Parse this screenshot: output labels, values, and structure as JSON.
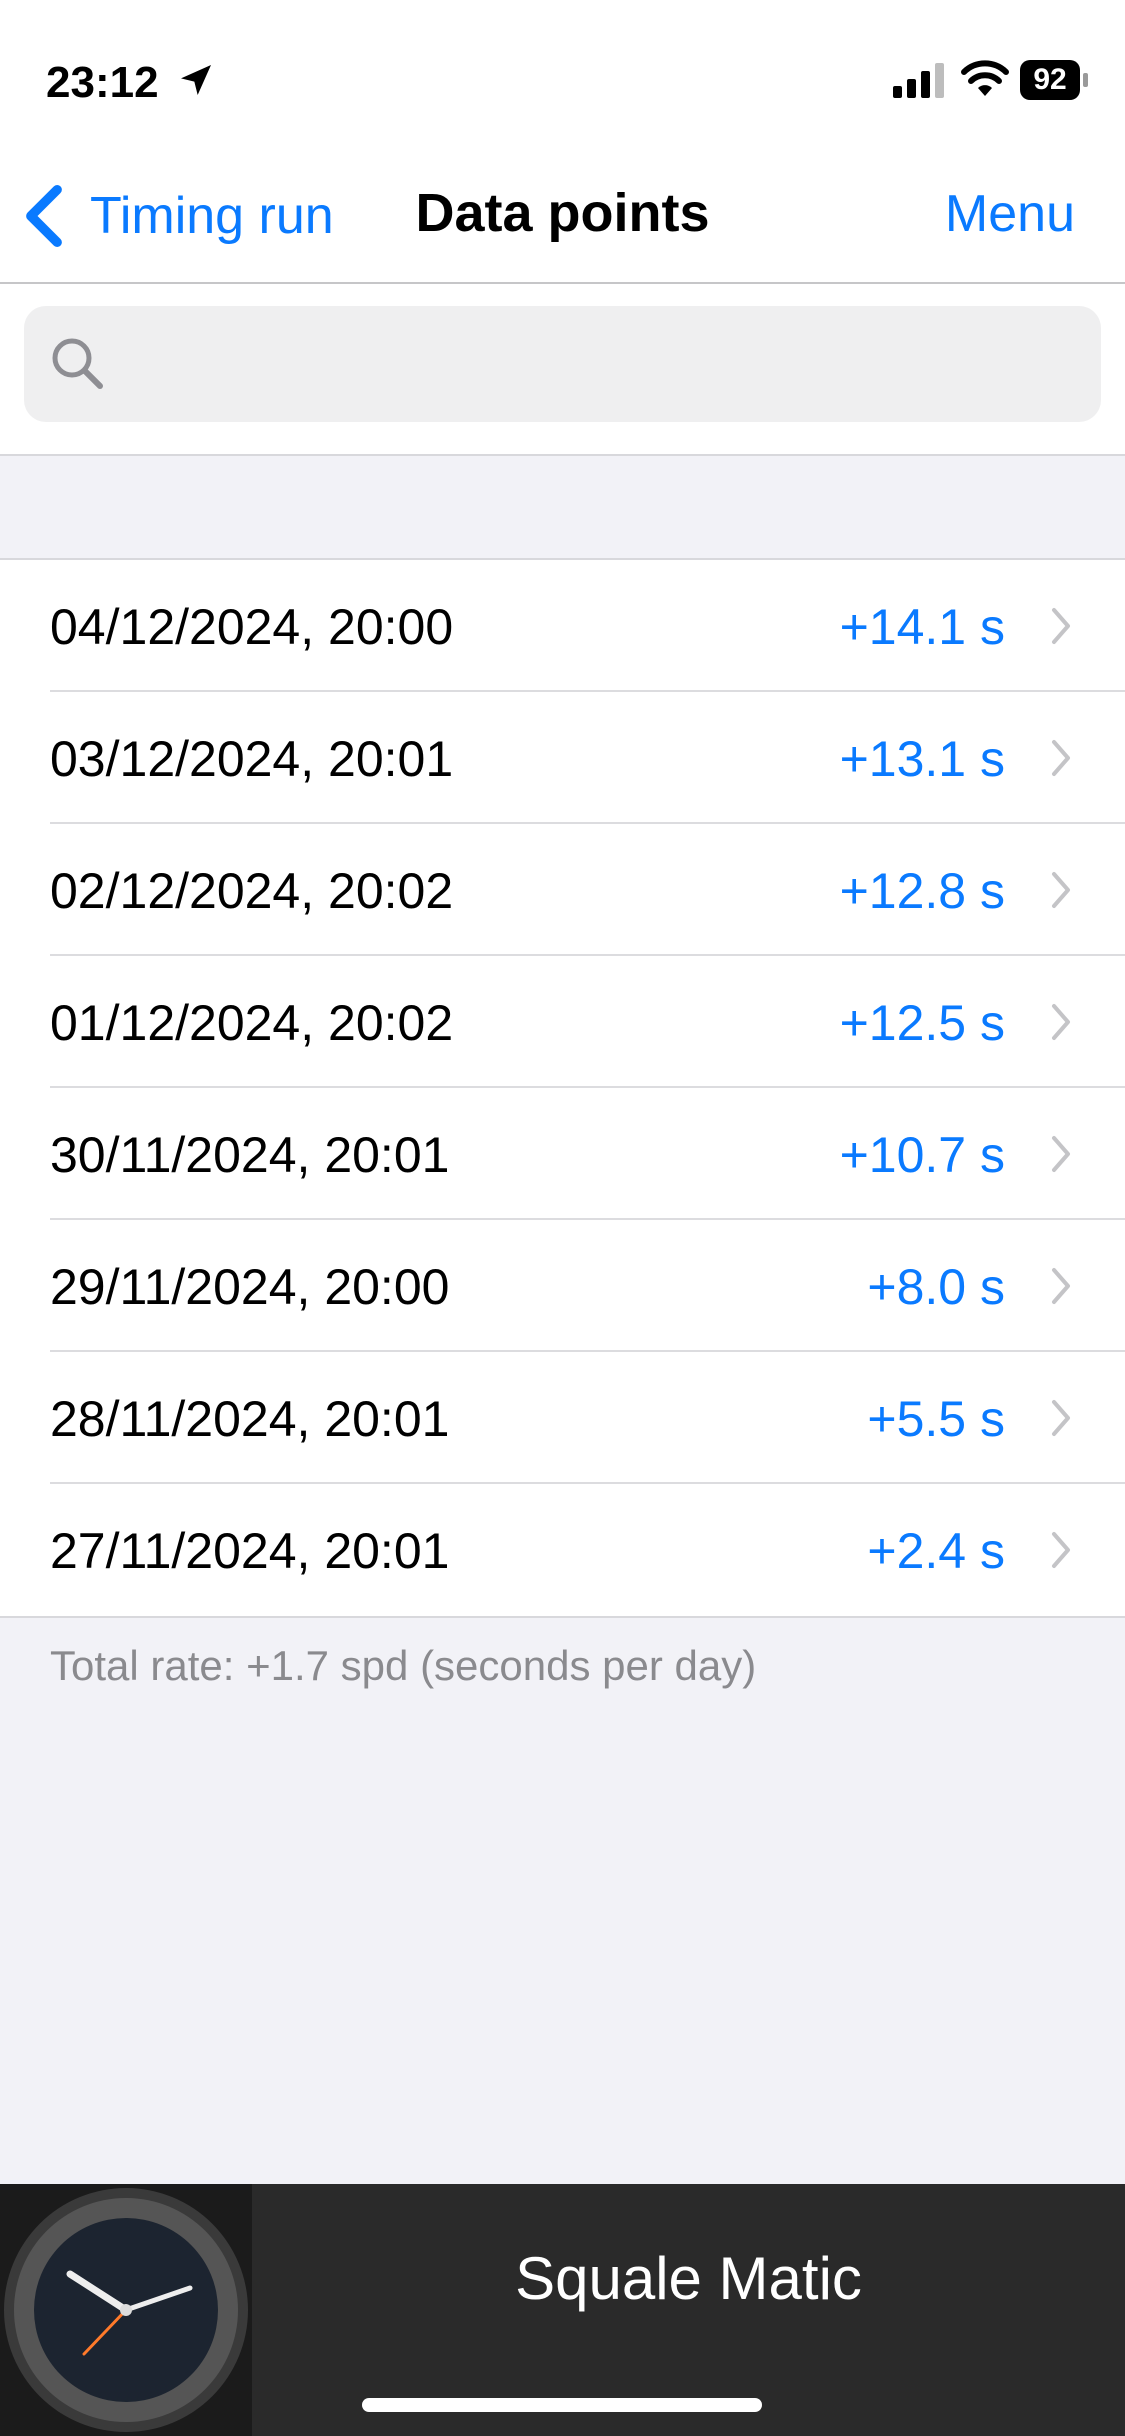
{
  "status": {
    "time": "23:12",
    "battery": "92"
  },
  "nav": {
    "back_label": "Timing run",
    "title": "Data points",
    "menu_label": "Menu"
  },
  "search": {
    "placeholder": ""
  },
  "rows": [
    {
      "date": "04/12/2024, 20:00",
      "value": "+14.1 s"
    },
    {
      "date": "03/12/2024, 20:01",
      "value": "+13.1 s"
    },
    {
      "date": "02/12/2024, 20:02",
      "value": "+12.8 s"
    },
    {
      "date": "01/12/2024, 20:02",
      "value": "+12.5 s"
    },
    {
      "date": "30/11/2024, 20:01",
      "value": "+10.7 s"
    },
    {
      "date": "29/11/2024, 20:00",
      "value": "+8.0 s"
    },
    {
      "date": "28/11/2024, 20:01",
      "value": "+5.5 s"
    },
    {
      "date": "27/11/2024, 20:01",
      "value": "+2.4 s"
    }
  ],
  "footer": {
    "text": "Total rate: +1.7 spd (seconds per day)"
  },
  "banner": {
    "watch_name": "Squale Matic"
  },
  "colors": {
    "accent": "#0a7aff",
    "background": "#f2f2f7",
    "separator": "#dcdcdf"
  },
  "icons": {
    "location": "location-arrow-icon",
    "signal": "cellular-signal-icon",
    "wifi": "wifi-icon",
    "battery": "battery-icon",
    "back": "chevron-left-icon",
    "search": "magnifying-glass-icon",
    "row": "chevron-right-icon"
  }
}
